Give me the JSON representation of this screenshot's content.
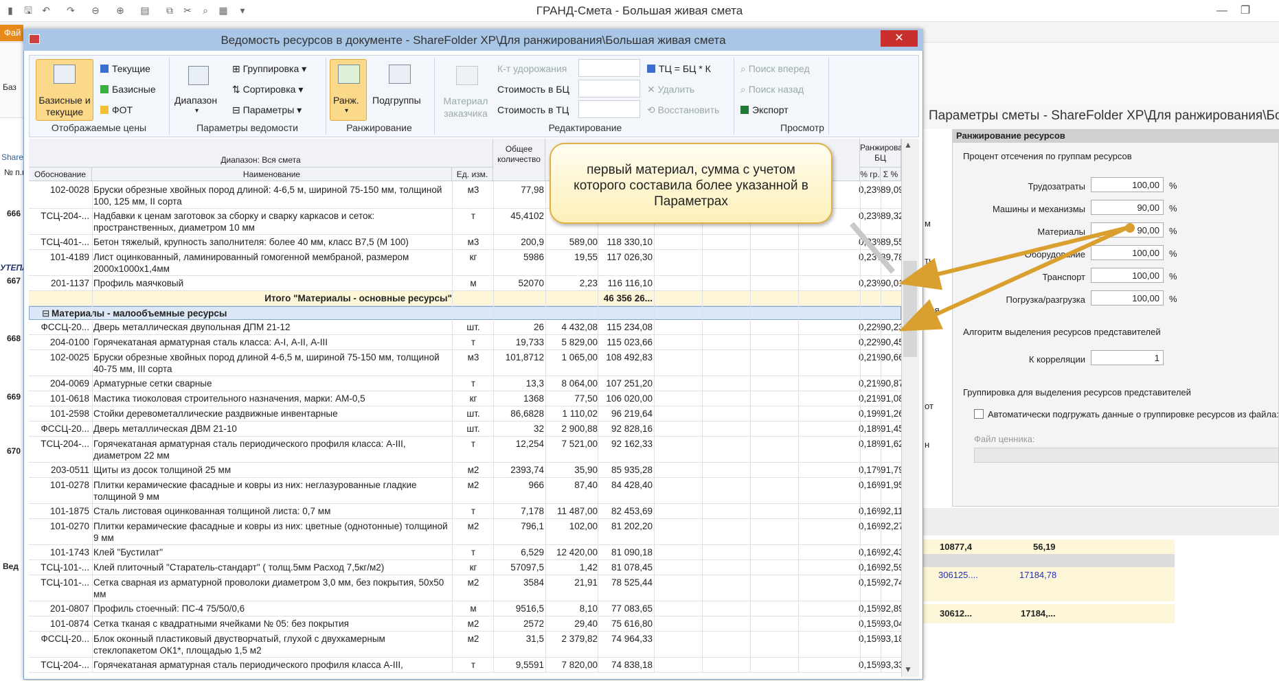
{
  "app": {
    "title": "ГРАНД-Смета - Большая живая смета",
    "file_tab": "Фай",
    "left_labels": [
      "Баз",
      "Share",
      "№ п.п",
      "666",
      "УТЕПЛ",
      "667",
      "668",
      "669",
      "670",
      "Вед"
    ]
  },
  "dialog": {
    "title": "Ведомость ресурсов в документе - ShareFolder XP\\Для ранжирования\\Большая живая смета",
    "close": "✕"
  },
  "ribbon": {
    "prices": {
      "big": "Базисные и текущие",
      "current": "Текущие",
      "basic": "Базисные",
      "fot": "ФОТ",
      "group": "Отображаемые цены"
    },
    "params": {
      "range": "Диапазон",
      "grouping": "Группировка",
      "sorting": "Сортировка",
      "params": "Параметры",
      "group": "Параметры ведомости"
    },
    "rank": {
      "rank": "Ранж.",
      "subgroups": "Подгруппы",
      "group": "Ранжирование"
    },
    "edit": {
      "customer_material": "Материал заказчика",
      "k_raise": "К-т удорожания",
      "cost_bc": "Стоимость в БЦ",
      "cost_tc": "Стоимость в ТЦ",
      "tc_formula": "ТЦ = БЦ * К",
      "delete": "Удалить",
      "restore": "Восстановить",
      "group": "Редактирование"
    },
    "view": {
      "find_next": "Поиск вперед",
      "find_prev": "Поиск назад",
      "export": "Экспорт",
      "group": "Просмотр"
    }
  },
  "table": {
    "header": {
      "range": "Диапазон: Вся смета",
      "basis": "Обоснование",
      "name": "Наименование",
      "unit": "Ед. изм.",
      "qty": "Общее количество",
      "rank": "Ранжирование БЦ",
      "pct": "% гр.",
      "sum_pct": "Σ %"
    },
    "rows": [
      {
        "t": "r",
        "h": 2,
        "b": "102-0028",
        "n": "Бруски обрезные хвойных пород длиной: 4-6,5 м, шириной 75-150 мм, толщиной 100, 125 мм, II сорта",
        "u": "м3",
        "q": "77,98",
        "p": "",
        "s": "",
        "g": "0,23%",
        "cp": "89,09%"
      },
      {
        "t": "r",
        "h": 2,
        "b": "ТСЦ-204-...",
        "n": "Надбавки к ценам заготовок за сборку и сварку каркасов и сеток: пространственных, диаметром 10 мм",
        "u": "т",
        "q": "45,4102",
        "p": "",
        "s": "",
        "g": "0,23%",
        "cp": "89,32%"
      },
      {
        "t": "r",
        "h": 1,
        "b": "ТСЦ-401-...",
        "n": "Бетон тяжелый, крупность заполнителя: более 40 мм, класс В7,5 (М 100)",
        "u": "м3",
        "q": "200,9",
        "p": "589,00",
        "s": "118 330,10",
        "g": "0,23%",
        "cp": "89,55%"
      },
      {
        "t": "r",
        "h": 2,
        "b": "101-4189",
        "n": "Лист оцинкованный, ламинированный гомогенной мембраной, размером 2000х1000х1,4мм",
        "u": "кг",
        "q": "5986",
        "p": "19,55",
        "s": "117 026,30",
        "g": "0,23%",
        "cp": "89,78%"
      },
      {
        "t": "r",
        "h": 1,
        "b": "201-1137",
        "n": "Профиль маячковый",
        "u": "м",
        "q": "52070",
        "p": "2,23",
        "s": "116 116,10",
        "g": "0,23%",
        "cp": "90,01%"
      },
      {
        "t": "total",
        "label": "Итого \"Материалы - основные ресурсы\"",
        "s": "46 356 26..."
      },
      {
        "t": "group",
        "label": "Материалы - малообъемные ресурсы"
      },
      {
        "t": "r",
        "h": 1,
        "b": "ФССЦ-20...",
        "n": "Дверь  металлическая  двупольная ДПМ 21-12",
        "u": "шт.",
        "q": "26",
        "p": "4 432,08",
        "s": "115 234,08",
        "g": "0,22%",
        "cp": "90,23%"
      },
      {
        "t": "r",
        "h": 1,
        "b": "204-0100",
        "n": "Горячекатаная арматурная сталь класса: А-I, А-II, А-III",
        "u": "т",
        "q": "19,733",
        "p": "5 829,00",
        "s": "115 023,66",
        "g": "0,22%",
        "cp": "90,45%"
      },
      {
        "t": "r",
        "h": 2,
        "b": "102-0025",
        "n": "Бруски обрезные хвойных пород длиной 4-6,5 м, шириной 75-150 мм, толщиной 40-75 мм, III сорта",
        "u": "м3",
        "q": "101,8712",
        "p": "1 065,00",
        "s": "108 492,83",
        "g": "0,21%",
        "cp": "90,66%"
      },
      {
        "t": "r",
        "h": 1,
        "b": "204-0069",
        "n": "Арматурные сетки сварные",
        "u": "т",
        "q": "13,3",
        "p": "8 064,00",
        "s": "107 251,20",
        "g": "0,21%",
        "cp": "90,87%"
      },
      {
        "t": "r",
        "h": 1,
        "b": "101-0618",
        "n": "Мастика тиоколовая строительного назначения, марки: АМ-0,5",
        "u": "кг",
        "q": "1368",
        "p": "77,50",
        "s": "106 020,00",
        "g": "0,21%",
        "cp": "91,08%"
      },
      {
        "t": "r",
        "h": 1,
        "b": "101-2598",
        "n": "Стойки деревометаллические раздвижные инвентарные",
        "u": "шт.",
        "q": "86,6828",
        "p": "1 110,02",
        "s": "96 219,64",
        "g": "0,19%",
        "cp": "91,26%"
      },
      {
        "t": "r",
        "h": 1,
        "b": "ФССЦ-20...",
        "n": "Дверь  металлическая ДВМ 21-10",
        "u": "шт.",
        "q": "32",
        "p": "2 900,88",
        "s": "92 828,16",
        "g": "0,18%",
        "cp": "91,45%"
      },
      {
        "t": "r",
        "h": 2,
        "b": "ТСЦ-204-...",
        "n": "Горячекатаная арматурная сталь периодического профиля класса: А-III, диаметром 22 мм",
        "u": "т",
        "q": "12,254",
        "p": "7 521,00",
        "s": "92 162,33",
        "g": "0,18%",
        "cp": "91,62%"
      },
      {
        "t": "r",
        "h": 1,
        "b": "203-0511",
        "n": "Щиты из досок толщиной 25 мм",
        "u": "м2",
        "q": "2393,74",
        "p": "35,90",
        "s": "85 935,28",
        "g": "0,17%",
        "cp": "91,79%"
      },
      {
        "t": "r",
        "h": 2,
        "b": "101-0278",
        "n": "Плитки керамические фасадные и ковры из них: неглазурованные гладкие толщиной 9 мм",
        "u": "м2",
        "q": "966",
        "p": "87,40",
        "s": "84 428,40",
        "g": "0,16%",
        "cp": "91,95%"
      },
      {
        "t": "r",
        "h": 1,
        "b": "101-1875",
        "n": "Сталь листовая оцинкованная толщиной листа: 0,7 мм",
        "u": "т",
        "q": "7,178",
        "p": "11 487,00",
        "s": "82 453,69",
        "g": "0,16%",
        "cp": "92,11%"
      },
      {
        "t": "r",
        "h": 2,
        "b": "101-0270",
        "n": "Плитки керамические фасадные и ковры из них: цветные (однотонные) толщиной 9 мм",
        "u": "м2",
        "q": "796,1",
        "p": "102,00",
        "s": "81 202,20",
        "g": "0,16%",
        "cp": "92,27%"
      },
      {
        "t": "r",
        "h": 1,
        "b": "101-1743",
        "n": "Клей \"Бустилат\"",
        "u": "т",
        "q": "6,529",
        "p": "12 420,00",
        "s": "81 090,18",
        "g": "0,16%",
        "cp": "92,43%"
      },
      {
        "t": "r",
        "h": 1,
        "b": "ТСЦ-101-...",
        "n": "Клей плиточный \"Старатель-стандарт\"  ( толщ.5мм  Расход 7,5кг/м2)",
        "u": "кг",
        "q": "57097,5",
        "p": "1,42",
        "s": "81 078,45",
        "g": "0,16%",
        "cp": "92,59%"
      },
      {
        "t": "r",
        "h": 2,
        "b": "ТСЦ-101-...",
        "n": "Сетка сварная из арматурной проволоки диаметром 3,0 мм, без покрытия, 50х50 мм",
        "u": "м2",
        "q": "3584",
        "p": "21,91",
        "s": "78 525,44",
        "g": "0,15%",
        "cp": "92,74%"
      },
      {
        "t": "r",
        "h": 1,
        "b": "201-0807",
        "n": "Профиль стоечный: ПС-4 75/50/0,6",
        "u": "м",
        "q": "9516,5",
        "p": "8,10",
        "s": "77 083,65",
        "g": "0,15%",
        "cp": "92,89%"
      },
      {
        "t": "r",
        "h": 1,
        "b": "101-0874",
        "n": "Сетка тканая с квадратными ячейками № 05: без покрытия",
        "u": "м2",
        "q": "2572",
        "p": "29,40",
        "s": "75 616,80",
        "g": "0,15%",
        "cp": "93,04%"
      },
      {
        "t": "r",
        "h": 2,
        "b": "ФССЦ-20...",
        "n": "Блок оконный пластиковый двустворчатый, глухой с двухкамерным стеклопакетом ОК1*, площадью  1,5 м2",
        "u": "м2",
        "q": "31,5",
        "p": "2 379,82",
        "s": "74 964,33",
        "g": "0,15%",
        "cp": "93,18%"
      },
      {
        "t": "r",
        "h": 1,
        "b": "ТСЦ-204-...",
        "n": "Горячекатаная арматурная сталь периодического профиля класса А-III,",
        "u": "т",
        "q": "9,5591",
        "p": "7 820,00",
        "s": "74 838,18",
        "g": "0,15%",
        "cp": "93,33%"
      }
    ]
  },
  "callout": "первый материал, сумма с учетом которого составила более указанной в Параметрах",
  "params": {
    "title": "Параметры сметы - ShareFolder XP\\Для ранжирования\\Большая живая смета",
    "section": "Ранжирование ресурсов",
    "cutoff_label": "Процент отсечения по группам ресурсов",
    "rows": [
      {
        "label": "Трудозатраты",
        "value": "100,00"
      },
      {
        "label": "Машины и механизмы",
        "value": "90,00"
      },
      {
        "label": "Материалы",
        "value": "90,00"
      },
      {
        "label": "Оборудование",
        "value": "100,00"
      },
      {
        "label": "Транспорт",
        "value": "100,00"
      },
      {
        "label": "Погрузка/разгрузка",
        "value": "100,00"
      }
    ],
    "percent": "%",
    "algo_label": "Алгоритм выделения ресурсов представителей",
    "corr_label": "К корреляции",
    "corr_value": "1",
    "grouping_label": "Группировка для выделения ресурсов представителей",
    "auto_load": "Автоматически подгружать данные о группировке ресурсов из файла:",
    "price_file": "Файл ценника:",
    "side_letters": [
      "м",
      "ты",
      "ния",
      "от",
      "н"
    ]
  },
  "bottom_grid": {
    "r1": [
      "10877,4",
      "56,19"
    ],
    "r2": [
      "306125....",
      "17184,78"
    ],
    "r3": [
      "30612...",
      "17184,..."
    ]
  },
  "colors": {
    "dialog_title": "#a9c6e6",
    "callout_border": "#e0b040",
    "arrow": "#d9a030",
    "group_row": "#dde8f6",
    "total_row": "#fdf6d8"
  }
}
